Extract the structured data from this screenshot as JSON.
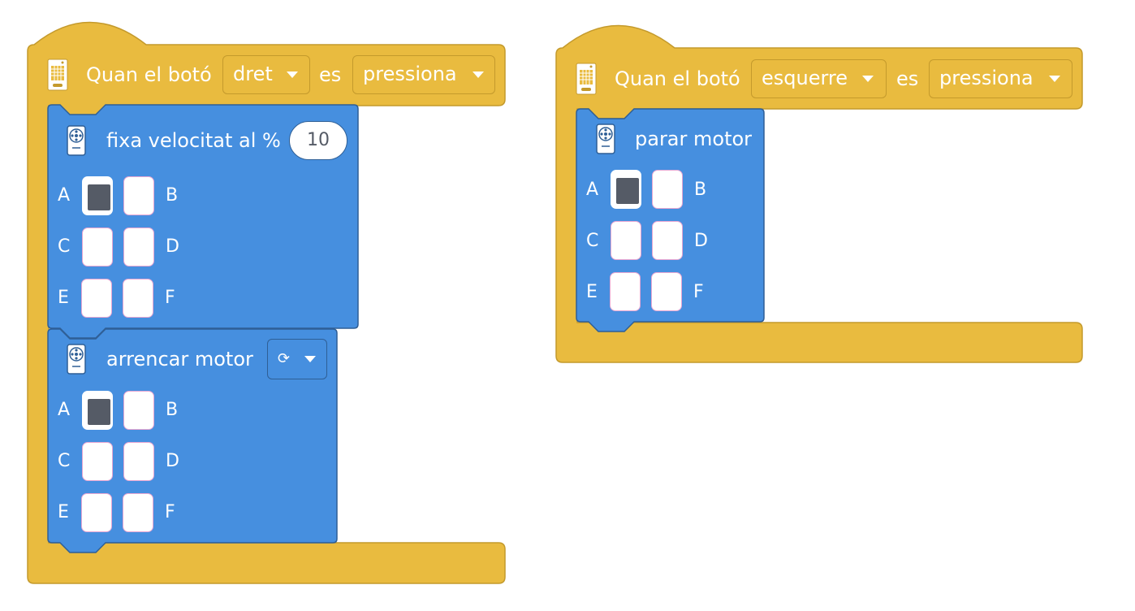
{
  "colors": {
    "events": "#e9bb3f",
    "events_border": "#c49a2c",
    "motor": "#468fdf",
    "motor_border": "#2f5f96",
    "port_selected": "#555b66"
  },
  "script1": {
    "hat": {
      "icon": "brick-hub-icon",
      "label_prefix": "Quan el botó",
      "button_dropdown": "dret",
      "label_mid": "es",
      "action_dropdown": "pressiona"
    },
    "set_speed": {
      "icon": "motor-icon",
      "label": "fixa velocitat al %",
      "value": "10",
      "ports": [
        {
          "letter": "A",
          "selected": true
        },
        {
          "letter": "B",
          "selected": false
        },
        {
          "letter": "C",
          "selected": false
        },
        {
          "letter": "D",
          "selected": false
        },
        {
          "letter": "E",
          "selected": false
        },
        {
          "letter": "F",
          "selected": false
        }
      ]
    },
    "start_motor": {
      "icon": "motor-icon",
      "label": "arrencar motor",
      "direction_icon": "clockwise-icon",
      "direction_glyph": "⟳",
      "ports": [
        {
          "letter": "A",
          "selected": true
        },
        {
          "letter": "B",
          "selected": false
        },
        {
          "letter": "C",
          "selected": false
        },
        {
          "letter": "D",
          "selected": false
        },
        {
          "letter": "E",
          "selected": false
        },
        {
          "letter": "F",
          "selected": false
        }
      ]
    }
  },
  "script2": {
    "hat": {
      "icon": "brick-hub-icon",
      "label_prefix": "Quan el botó",
      "button_dropdown": "esquerre",
      "label_mid": "es",
      "action_dropdown": "pressiona"
    },
    "stop_motor": {
      "icon": "motor-icon",
      "label": "parar motor",
      "ports": [
        {
          "letter": "A",
          "selected": true
        },
        {
          "letter": "B",
          "selected": false
        },
        {
          "letter": "C",
          "selected": false
        },
        {
          "letter": "D",
          "selected": false
        },
        {
          "letter": "E",
          "selected": false
        },
        {
          "letter": "F",
          "selected": false
        }
      ]
    }
  }
}
